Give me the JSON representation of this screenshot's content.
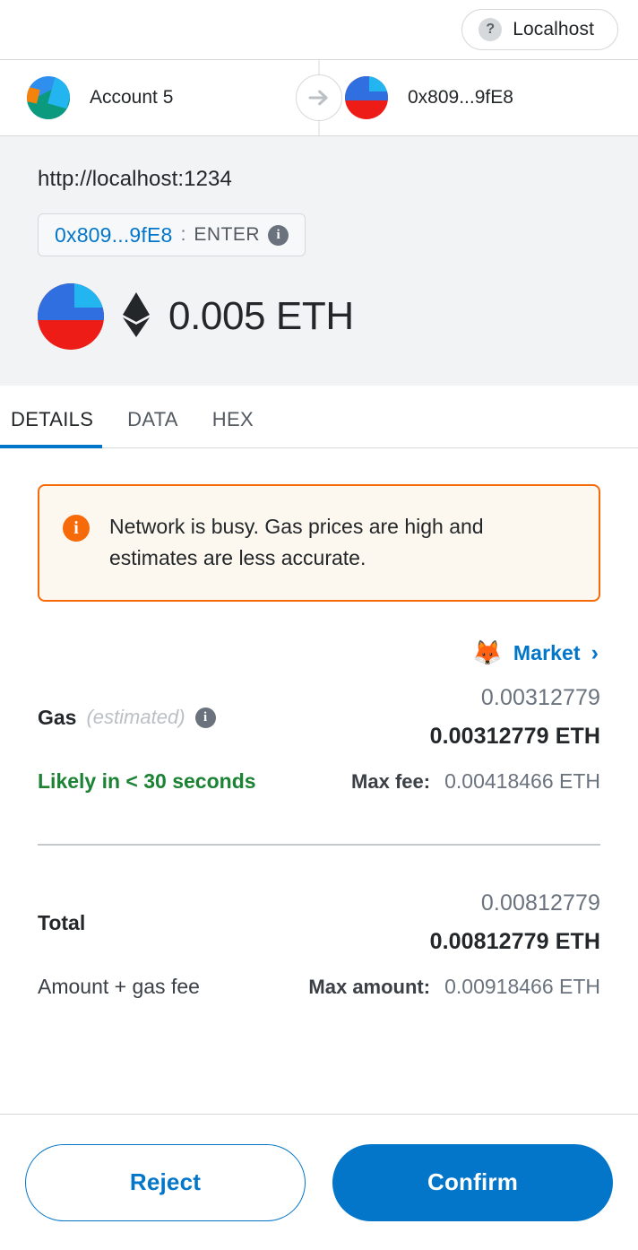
{
  "network": {
    "icon": "question-mark-icon",
    "name": "Localhost"
  },
  "parties": {
    "sender_name": "Account 5",
    "recipient_address": "0x809...9fE8",
    "arrow_icon": "arrow-right-icon"
  },
  "summary": {
    "origin_url": "http://localhost:1234",
    "subject_address": "0x809...9fE8",
    "subject_separator": ":",
    "subject_action": "ENTER",
    "subject_info_icon": "info-icon",
    "amount_text": "0.005 ETH",
    "token_icon": "ethereum-diamond-icon"
  },
  "tabs": [
    {
      "label": "DETAILS",
      "active": true
    },
    {
      "label": "DATA",
      "active": false
    },
    {
      "label": "HEX",
      "active": false
    }
  ],
  "alert": {
    "icon": "info-icon",
    "message": "Network is busy. Gas prices are high and estimates are less accurate."
  },
  "market": {
    "emoji": "🦊",
    "label": "Market",
    "chevron": "›"
  },
  "gas": {
    "title": "Gas",
    "estimate_note": "(estimated)",
    "info_icon": "info-icon",
    "fiat_value": "0.00312779",
    "native_value": "0.00312779 ETH",
    "speed_text": "Likely in < 30 seconds",
    "max_fee_label": "Max fee:",
    "max_fee_value": "0.00418466 ETH"
  },
  "total": {
    "title": "Total",
    "fiat_value": "0.00812779",
    "native_value": "0.00812779 ETH",
    "note": "Amount + gas fee",
    "max_amount_label": "Max amount:",
    "max_amount_value": "0.00918466 ETH"
  },
  "footer": {
    "reject_label": "Reject",
    "confirm_label": "Confirm"
  },
  "colors": {
    "accent": "#0376c9",
    "warning": "#f66a0a",
    "success": "#1c8234",
    "text": "#24272a",
    "muted": "#6a737d"
  }
}
